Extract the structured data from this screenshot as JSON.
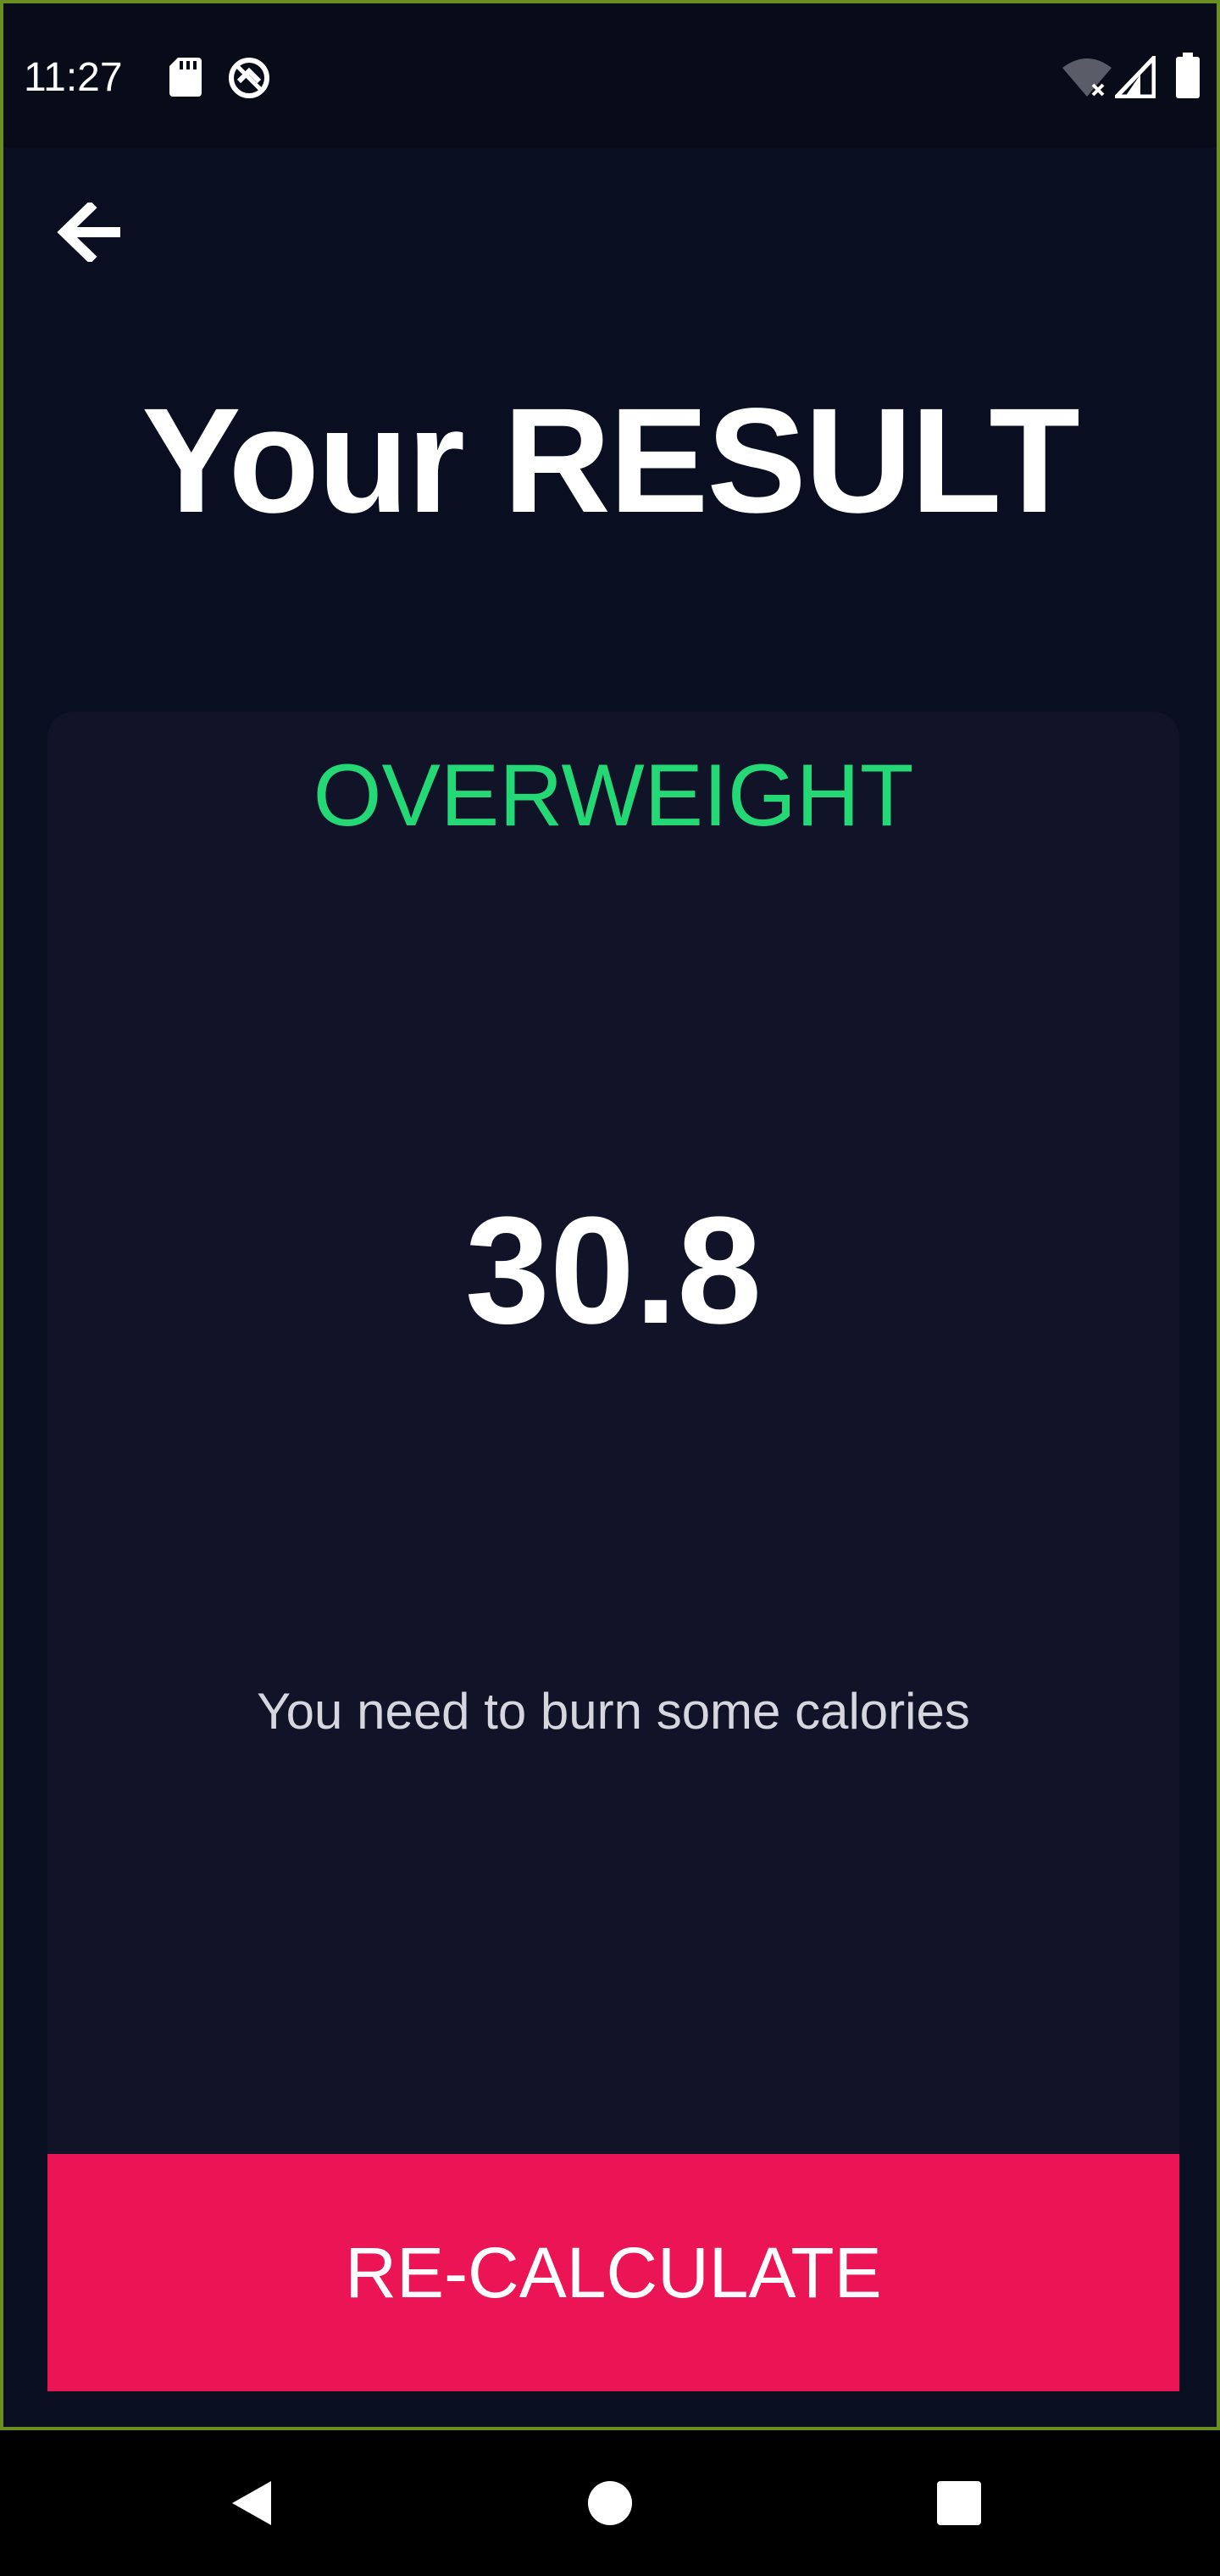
{
  "status_bar": {
    "time": "11:27",
    "icons": [
      "sd-card-icon",
      "sync-icon",
      "wifi-off-icon",
      "cell-signal-icon",
      "battery-icon"
    ]
  },
  "header": {
    "back_icon": "arrow-left-icon",
    "title": "Your RESULT"
  },
  "result": {
    "status": "OVERWEIGHT",
    "bmi": "30.8",
    "advice": "You need to burn some calories"
  },
  "actions": {
    "recalculate_label": "RE-CALCULATE"
  },
  "nav": {
    "icons": [
      "nav-back-icon",
      "nav-home-icon",
      "nav-recents-icon"
    ]
  },
  "colors": {
    "background": "#0a0e21",
    "card": "#111328",
    "status_green": "#24d876",
    "accent_pink": "#eb1555"
  }
}
